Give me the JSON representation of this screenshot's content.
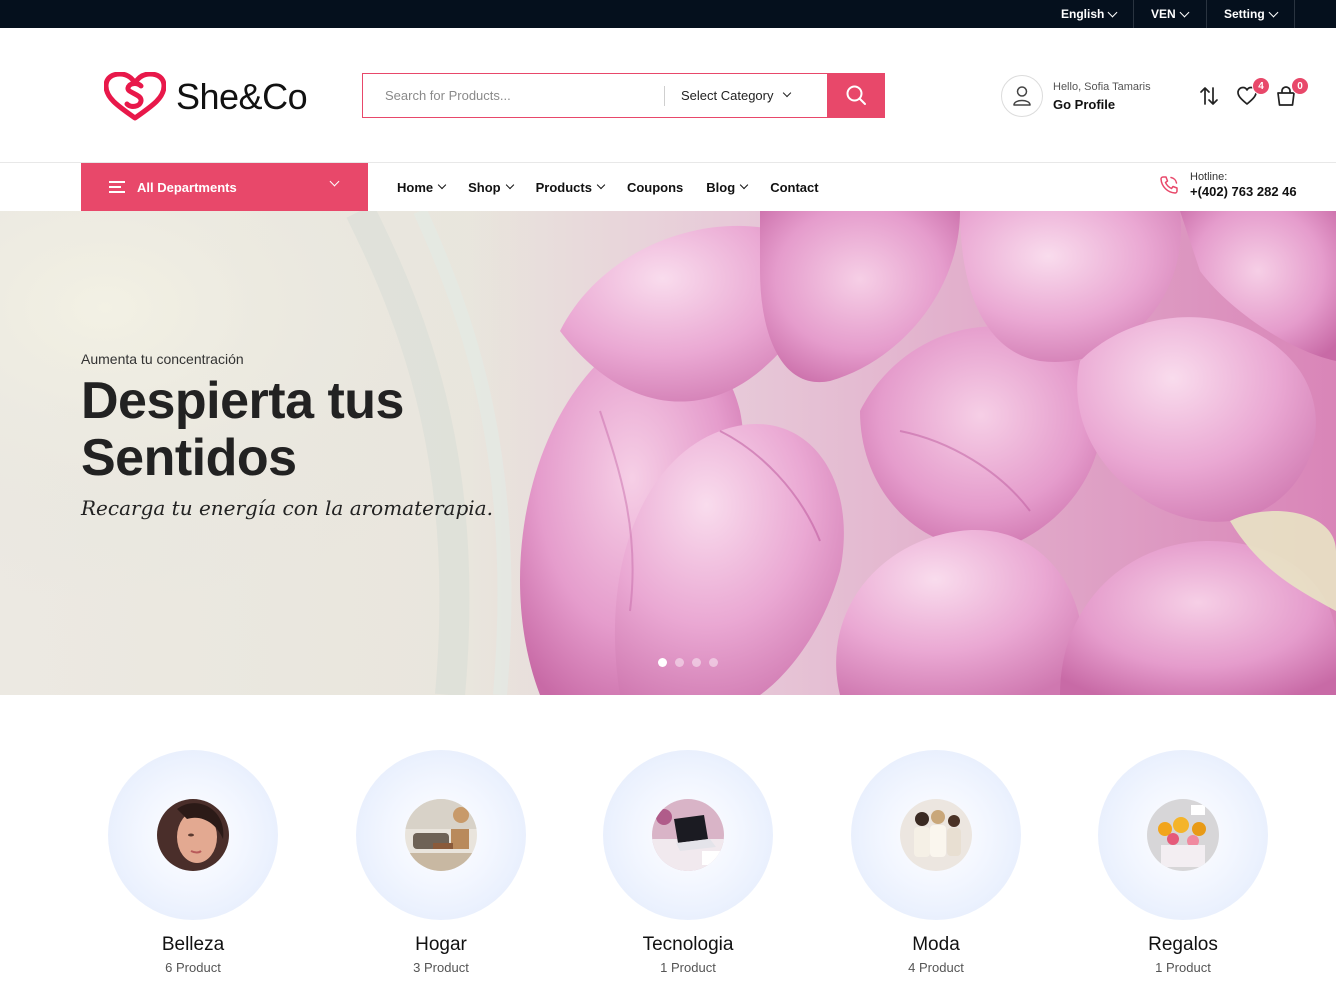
{
  "topbar": {
    "language": "English",
    "currency": "VEN",
    "setting": "Setting"
  },
  "header": {
    "logo_text": "She&Co",
    "search": {
      "placeholder": "Search for Products...",
      "category": "Select Category"
    },
    "profile": {
      "greeting": "Hello, Sofia Tamaris",
      "link": "Go Profile"
    },
    "wishlist_count": "4",
    "cart_count": "0"
  },
  "nav": {
    "departments": "All Departments",
    "items": [
      {
        "label": "Home"
      },
      {
        "label": "Shop"
      },
      {
        "label": "Products"
      },
      {
        "label": "Coupons"
      },
      {
        "label": "Blog"
      },
      {
        "label": "Contact"
      }
    ],
    "hotline_label": "Hotline:",
    "hotline_number": "+(402) 763 282 46"
  },
  "hero": {
    "eyebrow": "Aumenta tu concentración",
    "title_line1": "Despierta tus",
    "title_line2": "Sentidos",
    "subtitle": "Recarga tu energía con la aromaterapia.",
    "slides_total": 4,
    "active_slide": 1
  },
  "categories": [
    {
      "name": "Belleza",
      "count": "6 Product"
    },
    {
      "name": "Hogar",
      "count": "3 Product"
    },
    {
      "name": "Tecnologia",
      "count": "1 Product"
    },
    {
      "name": "Moda",
      "count": "4 Product"
    },
    {
      "name": "Regalos",
      "count": "1 Product"
    }
  ],
  "colors": {
    "accent": "#e8486a",
    "topbar": "#05101d",
    "text": "#111111"
  },
  "icons": {
    "search": "search-icon",
    "user": "user-icon",
    "compare": "compare-icon",
    "wishlist": "heart-icon",
    "cart": "cart-icon",
    "phone": "phone-icon",
    "menu": "menu-icon"
  }
}
